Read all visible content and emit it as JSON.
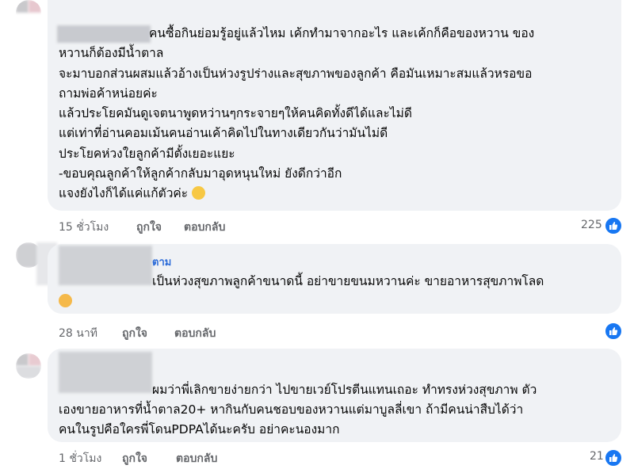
{
  "comments": [
    {
      "text_lines": [
        "คนซื้อกินย่อมรู้อยู่แล้วไหม เค้กทำมาจากอะไร และเค้กก็คือของหวาน ของ",
        "หวานก็ต้องมีน้ำตาล",
        "จะมาบอกส่วนผสมแล้วอ้างเป็นห่วงรูปร่างและสุขภาพของลูกค้า คือมันเหมาะสมแล้วหรอขอ",
        "ถามพ่อค้าหน่อยค่ะ",
        "แล้วประโยคมันดูเจตนาพูดหว่านๆกระจายๆให้คนคิดทั้งดีได้และไม่ดี",
        "แต่เท่าที่อ่านคอมเม้นคนอ่านเค้าคิดไปในทางเดียวกันว่ามันไม่ดี",
        "ประโยคห่วงใยลูกค้ามีตั้งเยอะแยะ",
        "-ขอบคุณลูกค้าให้ลูกค้ากลับมาอุดหนุนใหม่ ยังดีกว่าอีก",
        "แจงยังไงก็ได้แค่แก้ตัวค่ะ"
      ],
      "time": "15 ชั่วโมง",
      "like": "ถูกใจ",
      "reply": "ตอบกลับ",
      "reaction_count": "225"
    },
    {
      "name_partial": "ตาม",
      "text_lines": [
        "เป็นห่วงสุขภาพลูกค้าขนาดนี้ อย่าขายขนมหวานค่ะ ขายอาหารสุขภาพโลด"
      ],
      "time": "28 นาที",
      "like": "ถูกใจ",
      "reply": "ตอบกลับ"
    },
    {
      "text_lines": [
        "ผมว่าพี่เลิกขายง่ายกว่า ไปขายเวย์โปรตีนแทนเถอะ ทำทรงห่วงสุขภาพ ตัว",
        "เองขายอาหารที่น้ำตาล20+ หากินกับคนชอบของหวานแต่มาบูลลี่เขา ถ้ามีคนน่าสืบได้ว่า",
        "คนในรูปคือใครพี่โดนPDPAได้นะครับ อย่าคะนองมาก"
      ],
      "time": "1 ชั่วโมง",
      "like": "ถูกใจ",
      "reply": "ตอบกลับ",
      "reaction_count": "21"
    }
  ],
  "icons": {
    "reaction": "like-icon",
    "emoji1": "thinking-face-emoji",
    "emoji2": "sad-face-emoji"
  },
  "colors": {
    "bubble": "#f0f2f5",
    "like_blue": "#1877f2",
    "meta_gray": "#65676b",
    "name_blue": "#2d6cd8"
  }
}
